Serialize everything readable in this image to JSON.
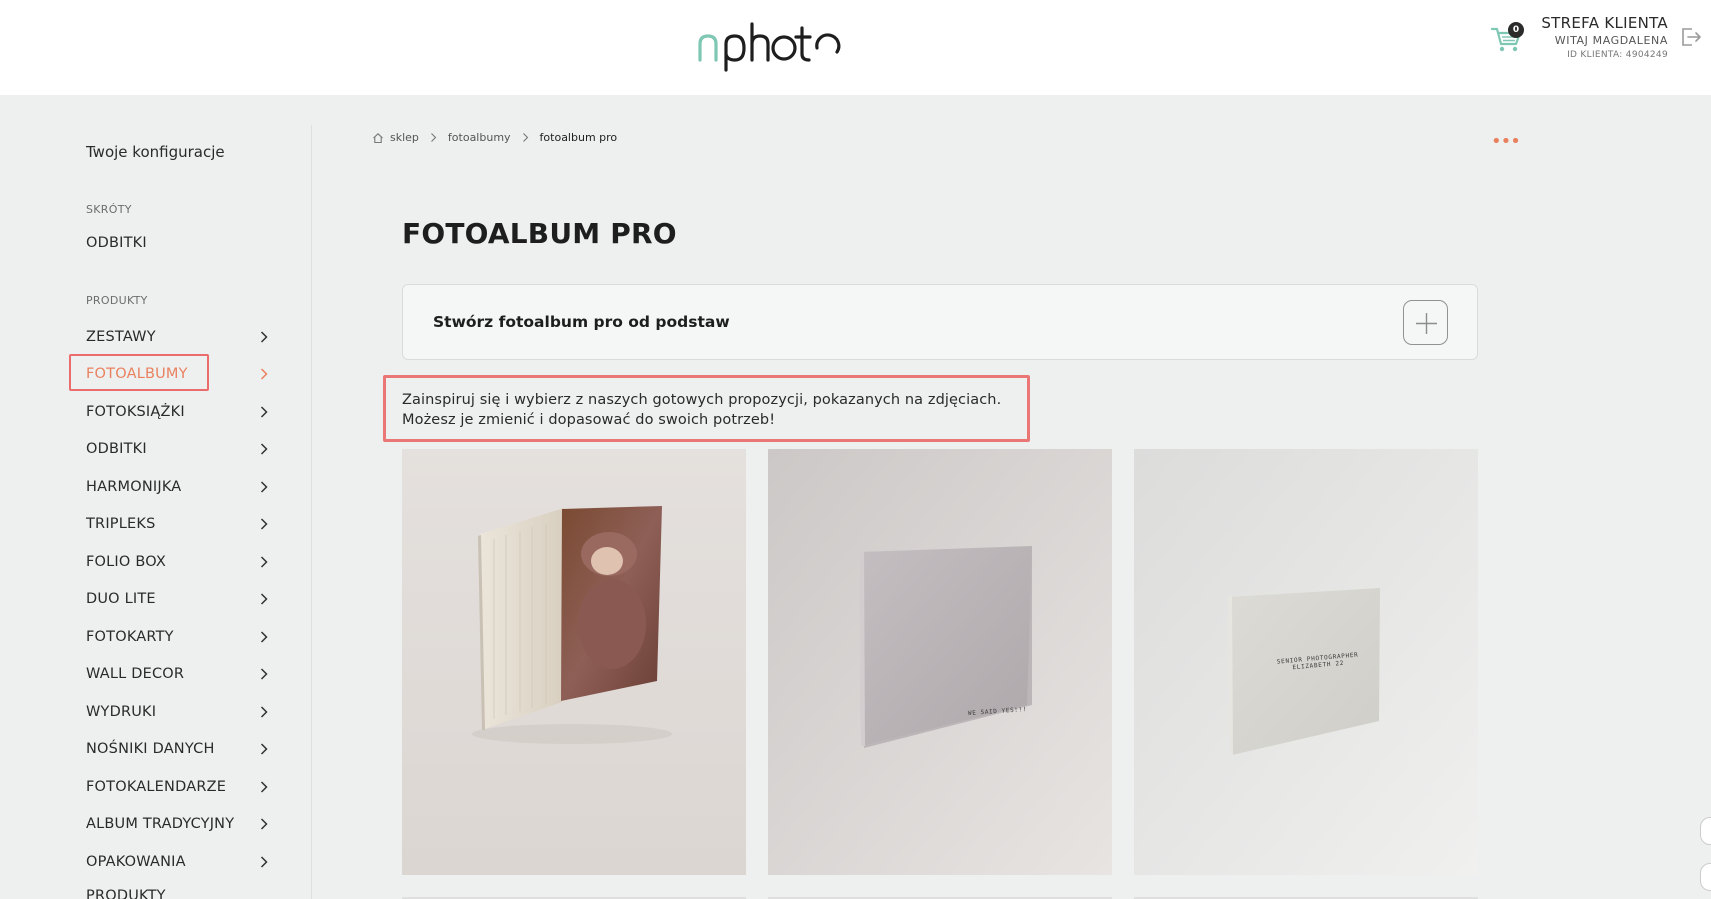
{
  "header": {
    "logo_text": "nphoto",
    "cart_count": "0",
    "client_title": "STREFA KLIENTA",
    "client_hello": "WITAJ MAGDALENA",
    "client_id": "ID KLIENTA: 4904249"
  },
  "sidebar": {
    "config_label": "Twoje konfiguracje",
    "shortcuts_title": "SKRÓTY",
    "shortcuts": [
      "ODBITKI"
    ],
    "products_title": "PRODUKTY",
    "items": [
      {
        "label": "ZESTAWY"
      },
      {
        "label": "FOTOALBUMY",
        "active": true
      },
      {
        "label": "FOTOKSIĄŻKI"
      },
      {
        "label": "ODBITKI"
      },
      {
        "label": "HARMONIJKA"
      },
      {
        "label": "TRIPLEKS"
      },
      {
        "label": "FOLIO BOX"
      },
      {
        "label": "DUO LITE"
      },
      {
        "label": "FOTOKARTY"
      },
      {
        "label": "WALL DECOR"
      },
      {
        "label": "WYDRUKI"
      },
      {
        "label": "NOŚNIKI DANYCH"
      },
      {
        "label": "FOTOKALENDARZE"
      },
      {
        "label": "ALBUM TRADYCYJNY"
      },
      {
        "label": "OPAKOWANIA"
      },
      {
        "label": "PRODUKTY"
      }
    ]
  },
  "breadcrumb": [
    "sklep",
    "fotoalbumy",
    "fotoalbum pro"
  ],
  "main": {
    "title": "FOTOALBUM PRO",
    "create_label": "Stwórz fotoalbum pro od podstaw",
    "info_line1": "Zainspiruj się i wybierz z naszych gotowych propozycji, pokazanych na zdjęciach.",
    "info_line2": "Możesz je zmienić i dopasować do swoich potrzeb!",
    "tiles": [
      {
        "name": "album-photo-cover"
      },
      {
        "name": "album-linen-we-said-yes",
        "cover_text": "WE SAID YES!!!"
      },
      {
        "name": "album-linen-senior",
        "cover_text_1": "SENIOR PHOTOGRAPHER",
        "cover_text_2": "ELIZABETH 22"
      }
    ]
  },
  "colors": {
    "accent": "#e9815f",
    "highlight_box": "#ea6c6c",
    "logo_teal": "#7ec7b3",
    "background": "#eef0f0"
  }
}
